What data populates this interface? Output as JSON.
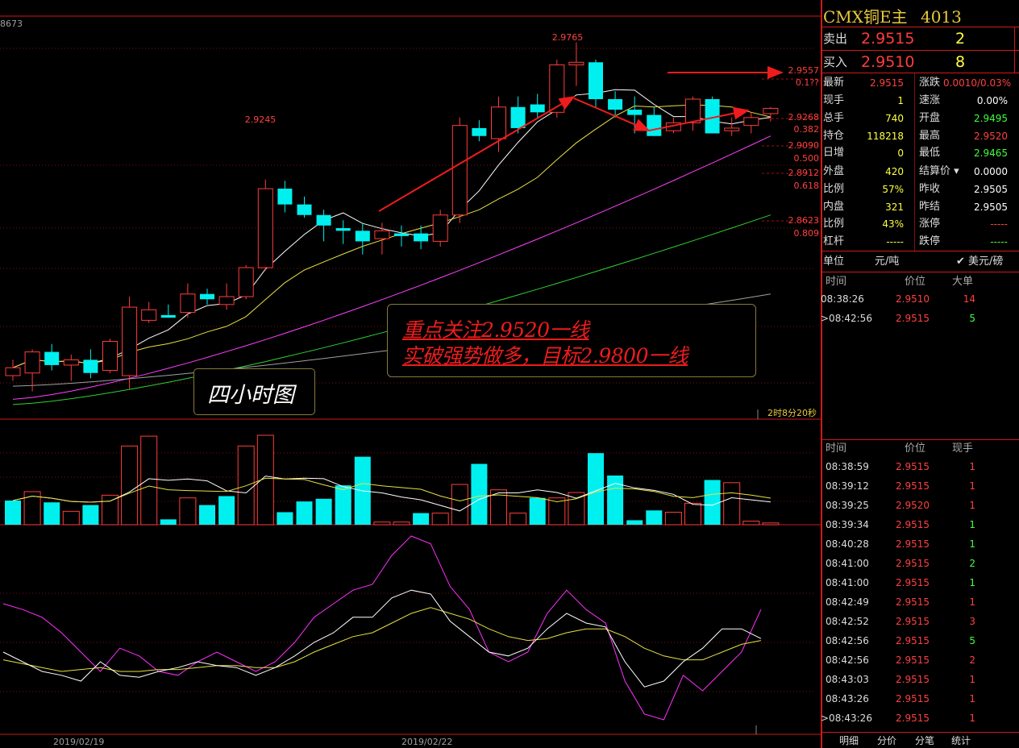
{
  "symbol": {
    "name": "CMX铜E主",
    "code": "4013"
  },
  "quote": {
    "sell_label": "卖出",
    "sell_price": "2.9515",
    "sell_vol": "2",
    "buy_label": "买入",
    "buy_price": "2.9510",
    "buy_vol": "8"
  },
  "stats_left": [
    {
      "label": "最新",
      "value": "2.9515",
      "color": "#ff4040"
    },
    {
      "label": "现手",
      "value": "1",
      "color": "#ffff40"
    },
    {
      "label": "总手",
      "value": "740",
      "color": "#ffff40"
    },
    {
      "label": "持仓",
      "value": "118218",
      "color": "#ffff40"
    },
    {
      "label": "日增",
      "value": "0",
      "color": "#ffff40"
    },
    {
      "label": "外盘",
      "value": "420",
      "color": "#ffff40"
    },
    {
      "label": "比例",
      "value": "57%",
      "color": "#ffff40"
    },
    {
      "label": "内盘",
      "value": "321",
      "color": "#ffff40"
    },
    {
      "label": "比例",
      "value": "43%",
      "color": "#ffff40"
    },
    {
      "label": "杠杆",
      "value": "-----",
      "color": "#ffff40"
    }
  ],
  "stats_right": [
    {
      "label": "涨跌",
      "value": "0.0010/0.03%",
      "color": "#ff4040"
    },
    {
      "label": "速涨",
      "value": "0.00%",
      "color": "#ffffff"
    },
    {
      "label": "开盘",
      "value": "2.9495",
      "color": "#40ff40"
    },
    {
      "label": "最高",
      "value": "2.9520",
      "color": "#ff4040"
    },
    {
      "label": "最低",
      "value": "2.9465",
      "color": "#40ff40"
    },
    {
      "label": "结算价",
      "value": "0.0000",
      "color": "#ffffff"
    },
    {
      "label": "昨收",
      "value": "2.9505",
      "color": "#ffffff"
    },
    {
      "label": "昨结",
      "value": "2.9505",
      "color": "#ffffff"
    },
    {
      "label": "涨停",
      "value": "-----",
      "color": "#ff4040"
    },
    {
      "label": "跌停",
      "value": "-----",
      "color": "#40ff40"
    }
  ],
  "unit": {
    "label": "单位",
    "value": "元/吨",
    "currency": "美元/磅"
  },
  "big_orders": {
    "headers": [
      "时间",
      "价位",
      "大单"
    ],
    "rows": [
      {
        "time": "08:38:26",
        "price": "2.9510",
        "vol": "14",
        "volColor": "#ff4040",
        "marker": ""
      },
      {
        "time": "08:42:56",
        "price": "2.9515",
        "vol": "5",
        "volColor": "#40ff40",
        "marker": ">"
      }
    ]
  },
  "ticks": {
    "headers": [
      "时间",
      "价位",
      "现手"
    ],
    "rows": [
      {
        "time": "08:38:59",
        "price": "2.9515",
        "vol": "1",
        "volColor": "#ff4040",
        "marker": ""
      },
      {
        "time": "08:39:12",
        "price": "2.9515",
        "vol": "1",
        "volColor": "#ff4040",
        "marker": ""
      },
      {
        "time": "08:39:25",
        "price": "2.9520",
        "vol": "1",
        "volColor": "#ff4040",
        "marker": ""
      },
      {
        "time": "08:39:34",
        "price": "2.9515",
        "vol": "1",
        "volColor": "#40ff40",
        "marker": ""
      },
      {
        "time": "08:40:28",
        "price": "2.9515",
        "vol": "1",
        "volColor": "#40ff40",
        "marker": ""
      },
      {
        "time": "08:41:00",
        "price": "2.9515",
        "vol": "2",
        "volColor": "#40ff40",
        "marker": ""
      },
      {
        "time": "08:41:00",
        "price": "2.9515",
        "vol": "1",
        "volColor": "#40ff40",
        "marker": ""
      },
      {
        "time": "08:42:49",
        "price": "2.9515",
        "vol": "1",
        "volColor": "#ff4040",
        "marker": ""
      },
      {
        "time": "08:42:52",
        "price": "2.9515",
        "vol": "3",
        "volColor": "#ff4040",
        "marker": ""
      },
      {
        "time": "08:42:56",
        "price": "2.9515",
        "vol": "5",
        "volColor": "#40ff40",
        "marker": ""
      },
      {
        "time": "08:42:56",
        "price": "2.9515",
        "vol": "2",
        "volColor": "#ff4040",
        "marker": ""
      },
      {
        "time": "08:43:03",
        "price": "2.9515",
        "vol": "1",
        "volColor": "#ff4040",
        "marker": ""
      },
      {
        "time": "08:43:26",
        "price": "2.9515",
        "vol": "1",
        "volColor": "#ff4040",
        "marker": ""
      },
      {
        "time": "08:43:26",
        "price": "2.9515",
        "vol": "1",
        "volColor": "#ff4040",
        "marker": ">"
      }
    ]
  },
  "tabs": [
    "明细",
    "分价",
    "分笔",
    "统计"
  ],
  "chart": {
    "top_left_value": "8673",
    "countdown": "2时8分20秒",
    "date_labels": [
      "2019/02/19",
      "2019/02/22"
    ],
    "high_label": "2.9765",
    "peak_label": "2.9245",
    "fib_levels": [
      {
        "price": "2.9557",
        "ratio": "0.1??"
      },
      {
        "price": "2.9268",
        "ratio": "0.382"
      },
      {
        "price": "2.9090",
        "ratio": "0.500"
      },
      {
        "price": "2.8912",
        "ratio": "0.618"
      },
      {
        "price": "2.8623",
        "ratio": "0.809"
      }
    ],
    "note_line1": "重点关注2.9520一线",
    "note_line2": "实破强势做多，目标2.9800一线",
    "bubble": "四小时图"
  },
  "chart_data": {
    "type": "candlestick",
    "ylim": [
      2.835,
      2.985
    ],
    "candles": [
      {
        "o": 2.85,
        "h": 2.856,
        "l": 2.848,
        "c": 2.853
      },
      {
        "o": 2.851,
        "h": 2.86,
        "l": 2.844,
        "c": 2.859
      },
      {
        "o": 2.859,
        "h": 2.862,
        "l": 2.852,
        "c": 2.854
      },
      {
        "o": 2.854,
        "h": 2.858,
        "l": 2.848,
        "c": 2.856
      },
      {
        "o": 2.856,
        "h": 2.86,
        "l": 2.849,
        "c": 2.851
      },
      {
        "o": 2.852,
        "h": 2.864,
        "l": 2.851,
        "c": 2.863
      },
      {
        "o": 2.85,
        "h": 2.88,
        "l": 2.845,
        "c": 2.876
      },
      {
        "o": 2.871,
        "h": 2.878,
        "l": 2.87,
        "c": 2.875
      },
      {
        "o": 2.873,
        "h": 2.877,
        "l": 2.872,
        "c": 2.872
      },
      {
        "o": 2.874,
        "h": 2.885,
        "l": 2.872,
        "c": 2.881
      },
      {
        "o": 2.881,
        "h": 2.883,
        "l": 2.877,
        "c": 2.879
      },
      {
        "o": 2.877,
        "h": 2.885,
        "l": 2.875,
        "c": 2.88
      },
      {
        "o": 2.88,
        "h": 2.892,
        "l": 2.879,
        "c": 2.891
      },
      {
        "o": 2.891,
        "h": 2.9245,
        "l": 2.89,
        "c": 2.921
      },
      {
        "o": 2.921,
        "h": 2.924,
        "l": 2.912,
        "c": 2.915
      },
      {
        "o": 2.915,
        "h": 2.918,
        "l": 2.91,
        "c": 2.911
      },
      {
        "o": 2.911,
        "h": 2.913,
        "l": 2.901,
        "c": 2.907
      },
      {
        "o": 2.906,
        "h": 2.909,
        "l": 2.9,
        "c": 2.905
      },
      {
        "o": 2.905,
        "h": 2.908,
        "l": 2.896,
        "c": 2.901
      },
      {
        "o": 2.902,
        "h": 2.908,
        "l": 2.896,
        "c": 2.905
      },
      {
        "o": 2.904,
        "h": 2.907,
        "l": 2.899,
        "c": 2.903
      },
      {
        "o": 2.904,
        "h": 2.907,
        "l": 2.898,
        "c": 2.901
      },
      {
        "o": 2.901,
        "h": 2.913,
        "l": 2.899,
        "c": 2.911
      },
      {
        "o": 2.911,
        "h": 2.948,
        "l": 2.908,
        "c": 2.945
      },
      {
        "o": 2.944,
        "h": 2.947,
        "l": 2.939,
        "c": 2.941
      },
      {
        "o": 2.94,
        "h": 2.956,
        "l": 2.935,
        "c": 2.952
      },
      {
        "o": 2.952,
        "h": 2.956,
        "l": 2.942,
        "c": 2.944
      },
      {
        "o": 2.953,
        "h": 2.957,
        "l": 2.948,
        "c": 2.95
      },
      {
        "o": 2.95,
        "h": 2.97,
        "l": 2.948,
        "c": 2.968
      },
      {
        "o": 2.968,
        "h": 2.9765,
        "l": 2.96,
        "c": 2.969
      },
      {
        "o": 2.969,
        "h": 2.97,
        "l": 2.952,
        "c": 2.955
      },
      {
        "o": 2.955,
        "h": 2.958,
        "l": 2.948,
        "c": 2.951
      },
      {
        "o": 2.951,
        "h": 2.956,
        "l": 2.942,
        "c": 2.949
      },
      {
        "o": 2.949,
        "h": 2.952,
        "l": 2.941,
        "c": 2.941
      },
      {
        "o": 2.943,
        "h": 2.948,
        "l": 2.942,
        "c": 2.946
      },
      {
        "o": 2.946,
        "h": 2.956,
        "l": 2.943,
        "c": 2.955
      },
      {
        "o": 2.955,
        "h": 2.956,
        "l": 2.942,
        "c": 2.942
      },
      {
        "o": 2.943,
        "h": 2.948,
        "l": 2.941,
        "c": 2.944
      },
      {
        "o": 2.945,
        "h": 2.95,
        "l": 2.942,
        "c": 2.948
      },
      {
        "o": 2.9495,
        "h": 2.952,
        "l": 2.9465,
        "c": 2.9515
      }
    ],
    "volume": [
      {
        "v": 0.27,
        "up": false
      },
      {
        "v": 0.37,
        "up": true
      },
      {
        "v": 0.25,
        "up": false
      },
      {
        "v": 0.15,
        "up": true
      },
      {
        "v": 0.22,
        "up": false
      },
      {
        "v": 0.33,
        "up": true
      },
      {
        "v": 0.88,
        "up": true
      },
      {
        "v": 0.99,
        "up": true
      },
      {
        "v": 0.06,
        "up": false
      },
      {
        "v": 0.3,
        "up": true
      },
      {
        "v": 0.22,
        "up": false
      },
      {
        "v": 0.32,
        "up": false
      },
      {
        "v": 0.88,
        "up": true
      },
      {
        "v": 1.0,
        "up": true
      },
      {
        "v": 0.14,
        "up": false
      },
      {
        "v": 0.26,
        "up": false
      },
      {
        "v": 0.29,
        "up": false
      },
      {
        "v": 0.44,
        "up": false
      },
      {
        "v": 0.76,
        "up": false
      },
      {
        "v": 0.03,
        "up": true
      },
      {
        "v": 0.03,
        "up": true
      },
      {
        "v": 0.13,
        "up": false
      },
      {
        "v": 0.13,
        "up": true
      },
      {
        "v": 0.45,
        "up": true
      },
      {
        "v": 0.68,
        "up": false
      },
      {
        "v": 0.39,
        "up": true
      },
      {
        "v": 0.13,
        "up": true
      },
      {
        "v": 0.3,
        "up": false
      },
      {
        "v": 0.3,
        "up": true
      },
      {
        "v": 0.36,
        "up": true
      },
      {
        "v": 0.8,
        "up": false
      },
      {
        "v": 0.55,
        "up": false
      },
      {
        "v": 0.05,
        "up": false
      },
      {
        "v": 0.16,
        "up": false
      },
      {
        "v": 0.14,
        "up": true
      },
      {
        "v": 0.24,
        "up": true
      },
      {
        "v": 0.5,
        "up": false
      },
      {
        "v": 0.47,
        "up": true
      },
      {
        "v": 0.04,
        "up": true
      },
      {
        "v": 0.02,
        "up": true
      }
    ],
    "oscillator": {
      "k": [
        40,
        35,
        30,
        28,
        25,
        35,
        28,
        27,
        30,
        32,
        35,
        33,
        32,
        28,
        32,
        38,
        45,
        50,
        58,
        58,
        68,
        72,
        70,
        56,
        48,
        40,
        38,
        42,
        52,
        60,
        55,
        53,
        35,
        22,
        25,
        35,
        42,
        52,
        52,
        47
      ],
      "d": [
        36,
        34,
        32,
        30,
        31,
        32,
        30,
        30,
        31,
        31,
        32,
        33,
        33,
        32,
        32,
        35,
        40,
        44,
        48,
        50,
        55,
        60,
        63,
        60,
        57,
        52,
        48,
        46,
        47,
        50,
        52,
        52,
        48,
        42,
        38,
        36,
        36,
        40,
        44,
        46
      ],
      "j": [
        65,
        62,
        58,
        50,
        40,
        30,
        42,
        38,
        30,
        28,
        35,
        40,
        35,
        30,
        35,
        45,
        58,
        65,
        72,
        75,
        90,
        100,
        96,
        74,
        62,
        40,
        35,
        40,
        60,
        72,
        62,
        55,
        25,
        8,
        5,
        28,
        20,
        30,
        40,
        62
      ]
    }
  }
}
